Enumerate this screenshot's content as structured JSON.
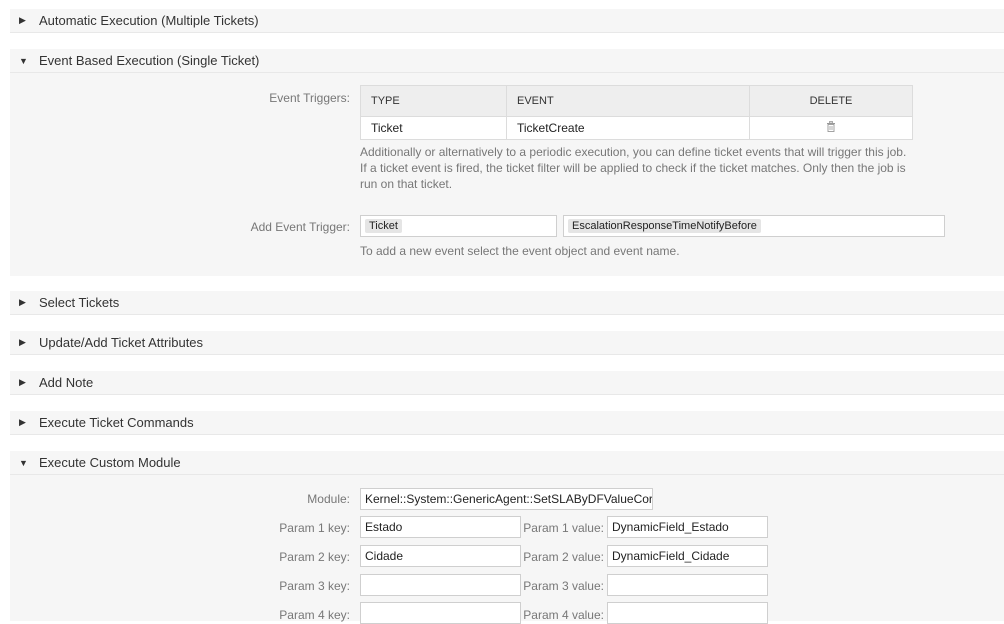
{
  "sections": {
    "automatic": "Automatic Execution (Multiple Tickets)",
    "event_based": "Event Based Execution (Single Ticket)",
    "select_tickets": "Select Tickets",
    "update_attrs": "Update/Add Ticket Attributes",
    "add_note": "Add Note",
    "exec_commands": "Execute Ticket Commands",
    "exec_module": "Execute Custom Module"
  },
  "event_triggers": {
    "label": "Event Triggers:",
    "columns": {
      "type": "TYPE",
      "event": "EVENT",
      "delete": "DELETE"
    },
    "rows": [
      {
        "type": "Ticket",
        "event": "TicketCreate"
      }
    ],
    "help": "Additionally or alternatively to a periodic execution, you can define ticket events that will trigger this job. If a ticket event is fired, the ticket filter will be applied to check if the ticket matches. Only then the job is run on that ticket."
  },
  "add_event_trigger": {
    "label": "Add Event Trigger:",
    "object_value": "Ticket",
    "event_value": "EscalationResponseTimeNotifyBefore",
    "help": "To add a new event select the event object and event name."
  },
  "custom_module": {
    "module_label": "Module:",
    "module_value": "Kernel::System::GenericAgent::SetSLAByDFValueCor",
    "params": [
      {
        "key_label": "Param 1 key:",
        "key": "Estado",
        "value_label": "Param 1 value:",
        "value": "DynamicField_Estado"
      },
      {
        "key_label": "Param 2 key:",
        "key": "Cidade",
        "value_label": "Param 2 value:",
        "value": "DynamicField_Cidade"
      },
      {
        "key_label": "Param 3 key:",
        "key": "",
        "value_label": "Param 3 value:",
        "value": ""
      },
      {
        "key_label": "Param 4 key:",
        "key": "",
        "value_label": "Param 4 value:",
        "value": ""
      }
    ]
  }
}
